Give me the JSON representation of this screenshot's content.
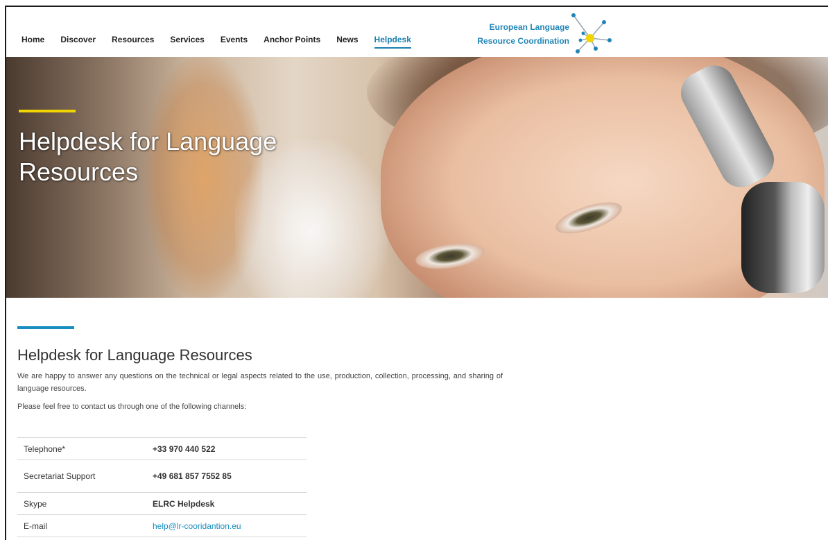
{
  "nav": {
    "items": [
      "Home",
      "Discover",
      "Resources",
      "Services",
      "Events",
      "Anchor Points",
      "News",
      "Helpdesk"
    ],
    "active": "Helpdesk"
  },
  "logo": {
    "line1": "European Language",
    "line2": "Resource Coordination"
  },
  "hero": {
    "title": "Helpdesk for Language Resources"
  },
  "main": {
    "heading": "Helpdesk for Language Resources",
    "intro": "We are happy to answer any questions on the technical or legal aspects related to the use, production, collection, processing, and sharing of language resources.",
    "channels_text": "Please feel free to contact us through one of the following channels:"
  },
  "contacts": [
    {
      "label": "Telephone*",
      "value": "+33 970 440 522"
    },
    {
      "label": "Secretariat Support",
      "value": "+49 681 857 7552 85"
    },
    {
      "label": "Skype",
      "value": "ELRC Helpdesk"
    },
    {
      "label": "E-mail",
      "value": "help@lr-cooridantion.eu"
    }
  ],
  "colors": {
    "accent_blue": "#1a8dbf",
    "accent_yellow": "#f2d400",
    "nav_active": "#1a7fb0"
  }
}
